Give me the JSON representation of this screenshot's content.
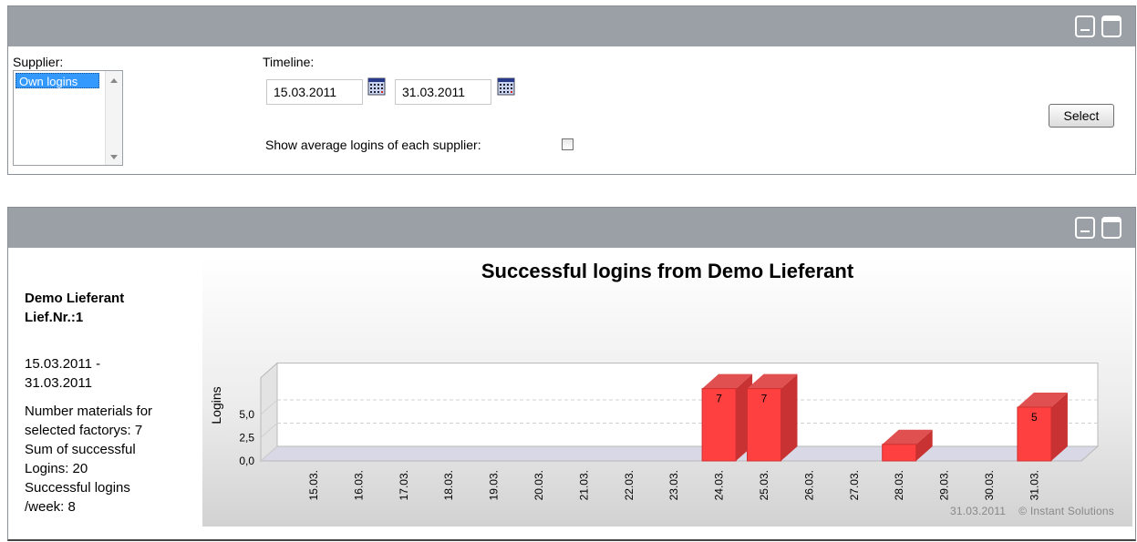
{
  "panel_filter": {
    "supplier_label": "Supplier:",
    "supplier_options": [
      "Own logins"
    ],
    "timeline_label": "Timeline:",
    "date_from": "15.03.2011",
    "date_to": "31.03.2011",
    "average_label": "Show average logins of each supplier:",
    "average_checked": false,
    "select_label": "Select"
  },
  "panel_result": {
    "supplier_name": "Demo Lieferant",
    "supplier_nr": "Lief.Nr.:1",
    "range_line1": "15.03.2011 -",
    "range_line2": "31.03.2011",
    "materials_line1": "Number materials for",
    "materials_line2": "selected factorys: 7",
    "sum_line1": "Sum of successful",
    "sum_line2": "Logins: 20",
    "week_line1": "Successful logins",
    "week_line2": "/week: 8",
    "footer_date": "31.03.2011",
    "footer_brand": "© Instant Solutions"
  },
  "colors": {
    "header": "#9aa0a6",
    "bar_front": "#ff4040",
    "bar_side": "#c83232",
    "bar_top": "#e05050",
    "selection": "#3399ff"
  },
  "chart_data": {
    "type": "bar",
    "title": "Successful logins from Demo Lieferant",
    "xlabel": "",
    "ylabel": "Logins",
    "categories": [
      "15.03.",
      "16.03.",
      "17.03.",
      "18.03.",
      "19.03.",
      "20.03.",
      "21.03.",
      "22.03.",
      "23.03.",
      "24.03.",
      "25.03.",
      "26.03.",
      "27.03.",
      "28.03.",
      "29.03.",
      "30.03.",
      "31.03."
    ],
    "values": [
      0,
      0,
      0,
      0,
      0,
      0,
      0,
      0,
      0,
      7,
      7,
      0,
      0,
      1,
      0,
      0,
      5
    ],
    "data_labels": [
      "",
      "",
      "",
      "",
      "",
      "",
      "",
      "",
      "",
      "7",
      "7",
      "",
      "",
      "",
      "",
      "",
      "5"
    ],
    "y_ticks": [
      "0,0",
      "2,5",
      "5,0"
    ],
    "ylim": [
      0,
      7
    ],
    "grid": true,
    "style": "3d"
  }
}
